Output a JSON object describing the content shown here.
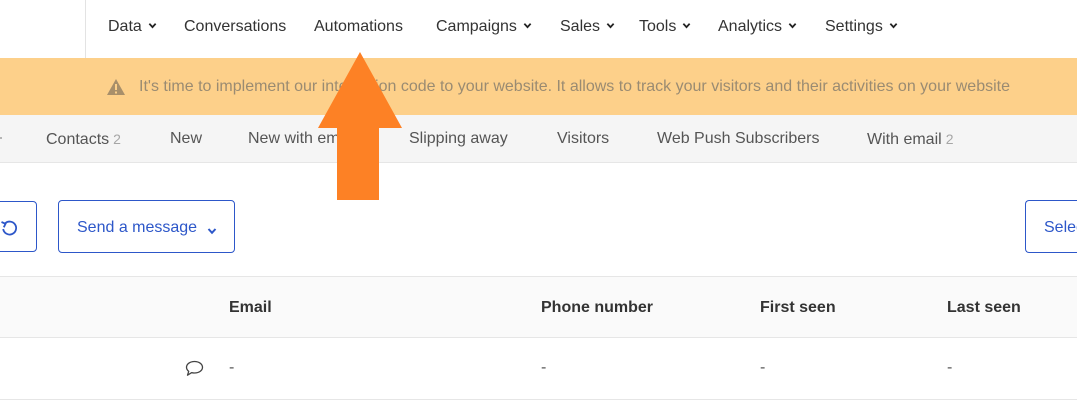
{
  "nav": {
    "items": [
      {
        "label": "Data",
        "dropdown": true
      },
      {
        "label": "Conversations",
        "dropdown": false
      },
      {
        "label": "Automations",
        "dropdown": false
      },
      {
        "label": "Campaigns",
        "dropdown": true
      },
      {
        "label": "Sales",
        "dropdown": true
      },
      {
        "label": "Tools",
        "dropdown": true
      },
      {
        "label": "Analytics",
        "dropdown": true
      },
      {
        "label": "Settings",
        "dropdown": true
      }
    ]
  },
  "banner": {
    "icon": "warning-triangle-icon",
    "text": "It's time to implement our integration code to your website. It allows to track your visitors and their activities on your website",
    "background": "#fdd08a"
  },
  "tabs": {
    "items": [
      {
        "label": "Contacts",
        "count": "2"
      },
      {
        "label": "New",
        "count": ""
      },
      {
        "label": "New with email",
        "count": ""
      },
      {
        "label": "Slipping away",
        "count": ""
      },
      {
        "label": "Visitors",
        "count": ""
      },
      {
        "label": "Web Push Subscribers",
        "count": ""
      },
      {
        "label": "With email",
        "count": "2"
      }
    ]
  },
  "toolbar": {
    "refresh_icon": "refresh-icon",
    "send_label": "Send a message",
    "select_label": "Select",
    "accent": "#2d57c9"
  },
  "table": {
    "columns": [
      "Email",
      "Phone number",
      "First seen",
      "Last seen"
    ],
    "rows": [
      {
        "email": "-",
        "phone": "-",
        "first_seen": "-",
        "last_seen": "-"
      }
    ]
  },
  "overlay": {
    "arrow_color": "#fd8125"
  }
}
